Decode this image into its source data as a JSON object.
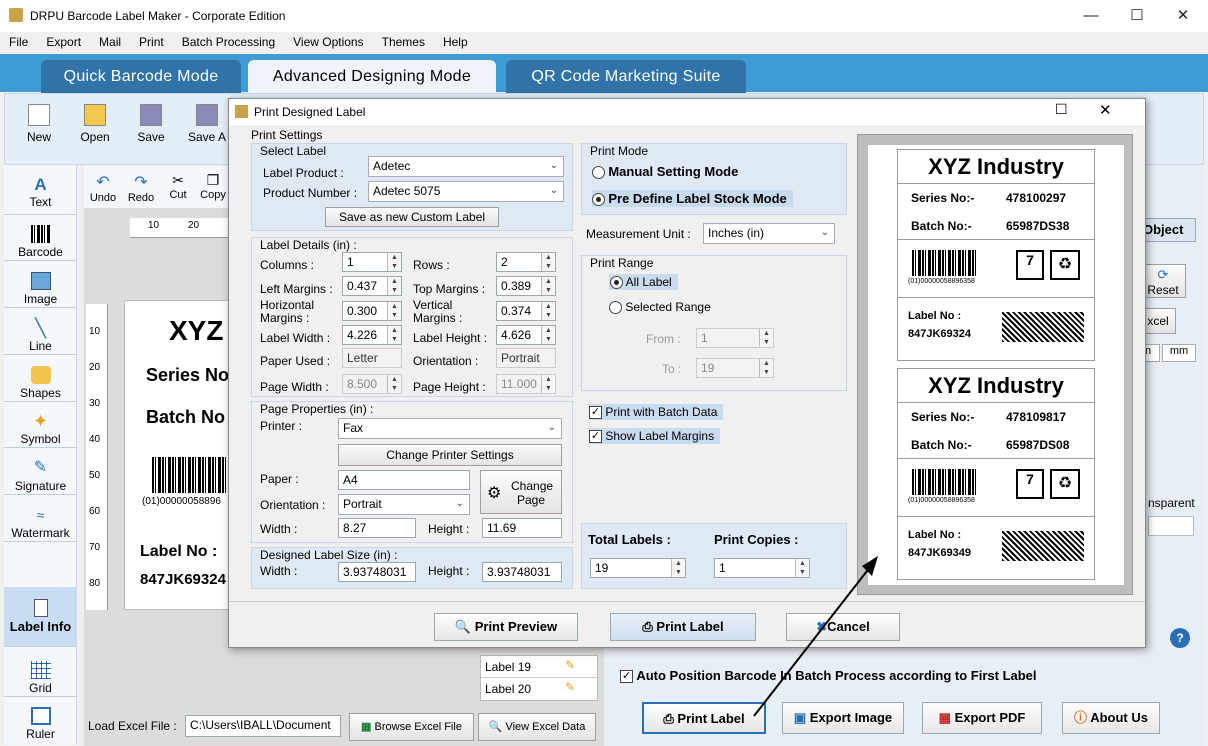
{
  "app_title": "DRPU Barcode Label Maker - Corporate Edition",
  "menu": [
    "File",
    "Export",
    "Mail",
    "Print",
    "Batch Processing",
    "View Options",
    "Themes",
    "Help"
  ],
  "mode_tabs": [
    "Quick Barcode Mode",
    "Advanced Designing Mode",
    "QR Code Marketing Suite"
  ],
  "toolbar": [
    "New",
    "Open",
    "Save",
    "Save A"
  ],
  "edit_toolbar": [
    "Undo",
    "Redo",
    "Cut",
    "Copy"
  ],
  "left_tools": [
    "Text",
    "Barcode",
    "Image",
    "Line",
    "Shapes",
    "Symbol",
    "Signature",
    "Watermark",
    "Label Info",
    "Grid",
    "Ruler"
  ],
  "canvas": {
    "ruler_ticks": [
      "10",
      "20"
    ],
    "vruler_ticks": [
      "10",
      "20",
      "30",
      "40",
      "50",
      "60",
      "70",
      "80"
    ],
    "title": "XYZ",
    "series": "Series No",
    "batch": "Batch No",
    "barcode_text": "(01)00000058896",
    "label_no": "Label No :",
    "label_val": "847JK69324"
  },
  "right_panel": {
    "object_tab": "Object",
    "reset": "Reset",
    "excel": "xcel",
    "unit_in": "n",
    "unit_mm": "mm",
    "transparent": "nsparent",
    "auto_position": "Auto Position Barcode In Batch Process according to First Label",
    "label19": "Label 19",
    "label20": "Label 20",
    "load_excel": "Load Excel File :",
    "excel_path": "C:\\Users\\IBALL\\Document",
    "browse_excel": "Browse Excel File",
    "view_excel": "View Excel Data",
    "print_label": "Print Label",
    "export_image": "Export Image",
    "export_pdf": "Export PDF",
    "about": "About Us"
  },
  "dialog": {
    "title": "Print Designed Label",
    "print_settings": "Print Settings",
    "select_label": "Select Label",
    "label_product_lbl": "Label Product :",
    "label_product": "Adetec",
    "product_number_lbl": "Product Number :",
    "product_number": "Adetec 5075",
    "save_custom": "Save as new Custom Label",
    "label_details": "Label Details (in) :",
    "columns_lbl": "Columns :",
    "columns": "1",
    "rows_lbl": "Rows :",
    "rows": "2",
    "left_margins_lbl": "Left Margins :",
    "left_margins": "0.437",
    "top_margins_lbl": "Top Margins :",
    "top_margins": "0.389",
    "hmargins_lbl1": "Horizontal",
    "hmargins_lbl2": "Margins :",
    "hmargins": "0.300",
    "vmargins_lbl1": "Vertical",
    "vmargins_lbl2": "Margins :",
    "vmargins": "0.374",
    "label_width_lbl": "Label Width :",
    "label_width": "4.226",
    "label_height_lbl": "Label Height :",
    "label_height": "4.626",
    "paper_used_lbl": "Paper Used :",
    "paper_used": "Letter",
    "orientation_lbl": "Orientation :",
    "orientation": "Portrait",
    "page_width_lbl": "Page Width :",
    "page_width": "8.500",
    "page_height_lbl": "Page Height :",
    "page_height": "11.000",
    "page_props": "Page Properties (in) :",
    "printer_lbl": "Printer :",
    "printer": "Fax",
    "change_printer": "Change Printer Settings",
    "paper_lbl": "Paper :",
    "paper": "A4",
    "orientation2_lbl": "Orientation :",
    "orientation2": "Portrait",
    "change_page_1": "Change",
    "change_page_2": "Page",
    "width_lbl": "Width :",
    "width": "8.27",
    "height_lbl": "Height :",
    "height": "11.69",
    "designed_size": "Designed Label Size (in) :",
    "dwidth_lbl": "Width :",
    "dwidth": "3.93748031",
    "dheight_lbl": "Height :",
    "dheight": "3.93748031",
    "print_mode": "Print Mode",
    "manual_mode": "Manual Setting Mode",
    "predefine_mode": "Pre Define Label Stock Mode",
    "measure_lbl": "Measurement Unit :",
    "measure": "Inches (in)",
    "print_range": "Print Range",
    "all_label": "All Label",
    "selected_range": "Selected Range",
    "from_lbl": "From :",
    "from": "1",
    "to_lbl": "To :",
    "to": "19",
    "with_batch": "Print with Batch Data",
    "show_margins": "Show Label Margins",
    "total_lbl": "Total Labels :",
    "total": "19",
    "copies_lbl": "Print Copies :",
    "copies": "1",
    "print_preview": "Print Preview",
    "print_label": "Print Label",
    "cancel": "Cancel"
  },
  "preview_labels": [
    {
      "title": "XYZ Industry",
      "series_lbl": "Series No:-",
      "series": "478100297",
      "batch_lbl": "Batch No:-",
      "batch": "65987DS38",
      "bc_text": "(01)00000058896358",
      "label_lbl": "Label No :",
      "label_no": "847JK69324"
    },
    {
      "title": "XYZ Industry",
      "series_lbl": "Series No:-",
      "series": "478109817",
      "batch_lbl": "Batch No:-",
      "batch": "65987DS08",
      "bc_text": "(01)00000058896358",
      "label_lbl": "Label No :",
      "label_no": "847JK69349"
    }
  ]
}
